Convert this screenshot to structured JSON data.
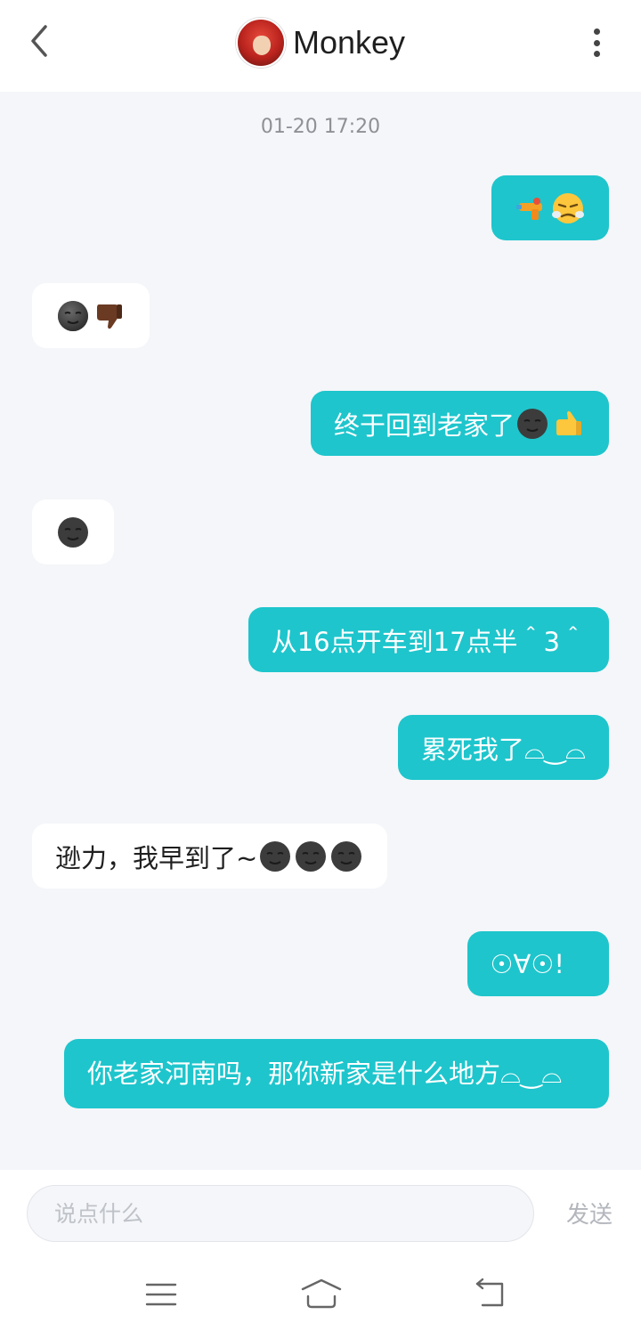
{
  "header": {
    "title": "Monkey"
  },
  "timestamp": "01-20 17:20",
  "messages": [
    {
      "side": "right",
      "text": "",
      "emojis": [
        "water-pistol",
        "triumph-face"
      ]
    },
    {
      "side": "left",
      "text": "",
      "emojis": [
        "new-moon-face",
        "thumbs-down"
      ]
    },
    {
      "side": "right",
      "text": "终于回到老家了",
      "emojis": [
        "new-moon-face",
        "thumbs-up"
      ]
    },
    {
      "side": "left",
      "text": "",
      "emojis": [
        "new-moon-face"
      ]
    },
    {
      "side": "right",
      "text": "从16点开车到17点半＾3＾",
      "emojis": []
    },
    {
      "side": "right",
      "text": "累死我了⌓‿⌓",
      "emojis": []
    },
    {
      "side": "left",
      "text": "逊力，我早到了~",
      "emojis": [
        "new-moon-face",
        "new-moon-face",
        "new-moon-face"
      ]
    },
    {
      "side": "right",
      "text": "☉∀☉!",
      "emojis": []
    },
    {
      "side": "right",
      "text": "你老家河南吗，那你新家是什么地方⌓‿⌓",
      "emojis": []
    }
  ],
  "input": {
    "placeholder": "说点什么",
    "value": "",
    "send_label": "发送"
  },
  "colors": {
    "accent": "#1ec5cc",
    "background": "#f4f6f9"
  }
}
